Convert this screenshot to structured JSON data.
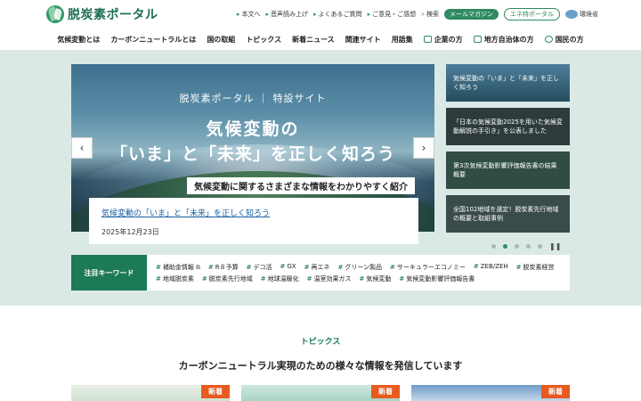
{
  "header": {
    "logo_text": "脱炭素ポータル",
    "util_links": [
      "本文へ",
      "音声読み上げ",
      "よくあるご質問",
      "ご意見・ご感想",
      "検索"
    ],
    "mail_magazine": "メールマガジン",
    "ene_portal": "エネ特ポータル",
    "ministry": "環境省"
  },
  "nav": {
    "items": [
      "気候変動とは",
      "カーボンニュートラルとは",
      "国の取組",
      "トピックス",
      "新着ニュース",
      "関連サイト",
      "用語集"
    ],
    "audience": [
      "企業の方",
      "地方自治体の方",
      "国民の方"
    ]
  },
  "hero": {
    "slide": {
      "kicker": "脱炭素ポータル ｜ 特設サイト",
      "title_line1": "気候変動の",
      "title_line2": "「いま」と「未来」を正しく知ろう",
      "subtitle": "気候変動に関するさまざまな情報をわかりやすく紹介"
    },
    "caption_link": "気候変動の「いま」と「未来」を正しく知ろう",
    "caption_date": "2025年12月23日",
    "prev": "‹",
    "next": "›",
    "pause": "❚❚",
    "side_cards": [
      "気候変動の「いま」と「未来」を正しく知ろう",
      "「日本の気候変動2025を用いた気候変動解説の手引き」を公表しました",
      "第3次気候変動影響評価報告書の結果概要",
      "全国102地域を選定！脱炭素先行地域の概要と取組事例"
    ]
  },
  "keywords": {
    "label": "注目キーワード",
    "items": [
      "補助金情報",
      "R８予算",
      "デコ活",
      "GX",
      "再エネ",
      "グリーン製品",
      "サーキュラーエコノミー",
      "ZEB/ZEH",
      "脱炭素経営",
      "地域脱炭素",
      "脱炭素先行地域",
      "地球温暖化",
      "温室効果ガス",
      "気候変動",
      "気候変動影響評価報告書"
    ]
  },
  "topics": {
    "label": "トピックス",
    "heading": "カーボンニュートラル実現のための様々な情報を発信しています",
    "badge": "新着"
  }
}
